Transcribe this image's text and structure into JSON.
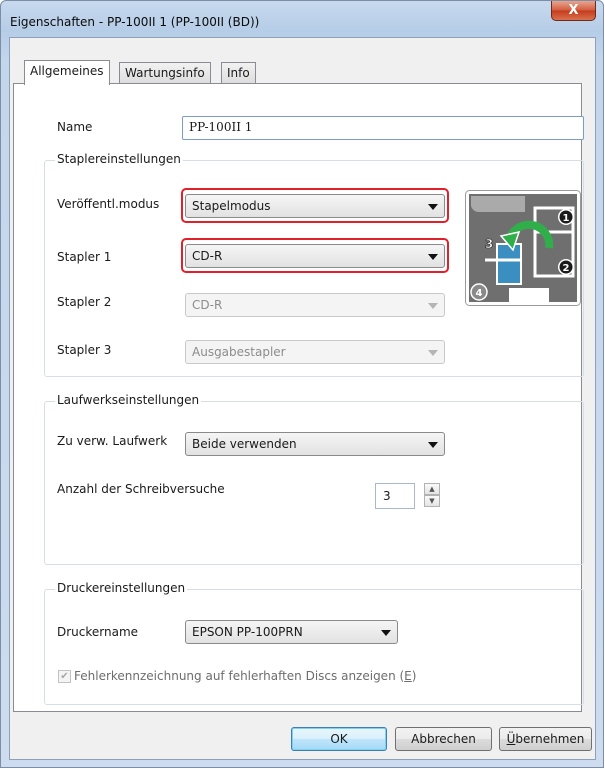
{
  "window": {
    "title": "Eigenschaften - PP-100II 1 (PP-100II (BD))",
    "close_glyph": "X"
  },
  "tabs": [
    {
      "label": "Allgemeines",
      "active": true
    },
    {
      "label": "Wartungsinfo",
      "active": false
    },
    {
      "label": "Info",
      "active": false
    }
  ],
  "general": {
    "name_label": "Name",
    "name_value": "PP-100II 1"
  },
  "stacker_settings": {
    "group_title": "Staplereinstellungen",
    "publish_mode_label": "Veröffentl.modus",
    "publish_mode_value": "Stapelmodus",
    "stacker1_label": "Stapler 1",
    "stacker1_value": "CD-R",
    "stacker2_label": "Stapler 2",
    "stacker2_value": "CD-R",
    "stacker3_label": "Stapler 3",
    "stacker3_value": "Ausgabestapler",
    "diagram_numbers": [
      "1",
      "2",
      "3",
      "4"
    ],
    "highlight_color": "#e0202a"
  },
  "drive_settings": {
    "group_title": "Laufwerkseinstellungen",
    "drive_label": "Zu verw. Laufwerk",
    "drive_value": "Beide verwenden",
    "write_attempts_label": "Anzahl der Schreibversuche",
    "write_attempts_value": "3"
  },
  "printer_settings": {
    "group_title": "Druckereinstellungen",
    "printer_name_label": "Druckername",
    "printer_name_value": "EPSON PP-100PRN",
    "error_mark_checked": true,
    "error_mark_label_before": "Fehlerkennzeichnung auf fehlerhaften Discs  anzeigen (",
    "error_mark_accel": "E",
    "error_mark_label_after": ")"
  },
  "buttons": {
    "ok": "OK",
    "cancel": "Abbrechen",
    "apply_accel": "Ü",
    "apply_rest": "bernehmen"
  }
}
